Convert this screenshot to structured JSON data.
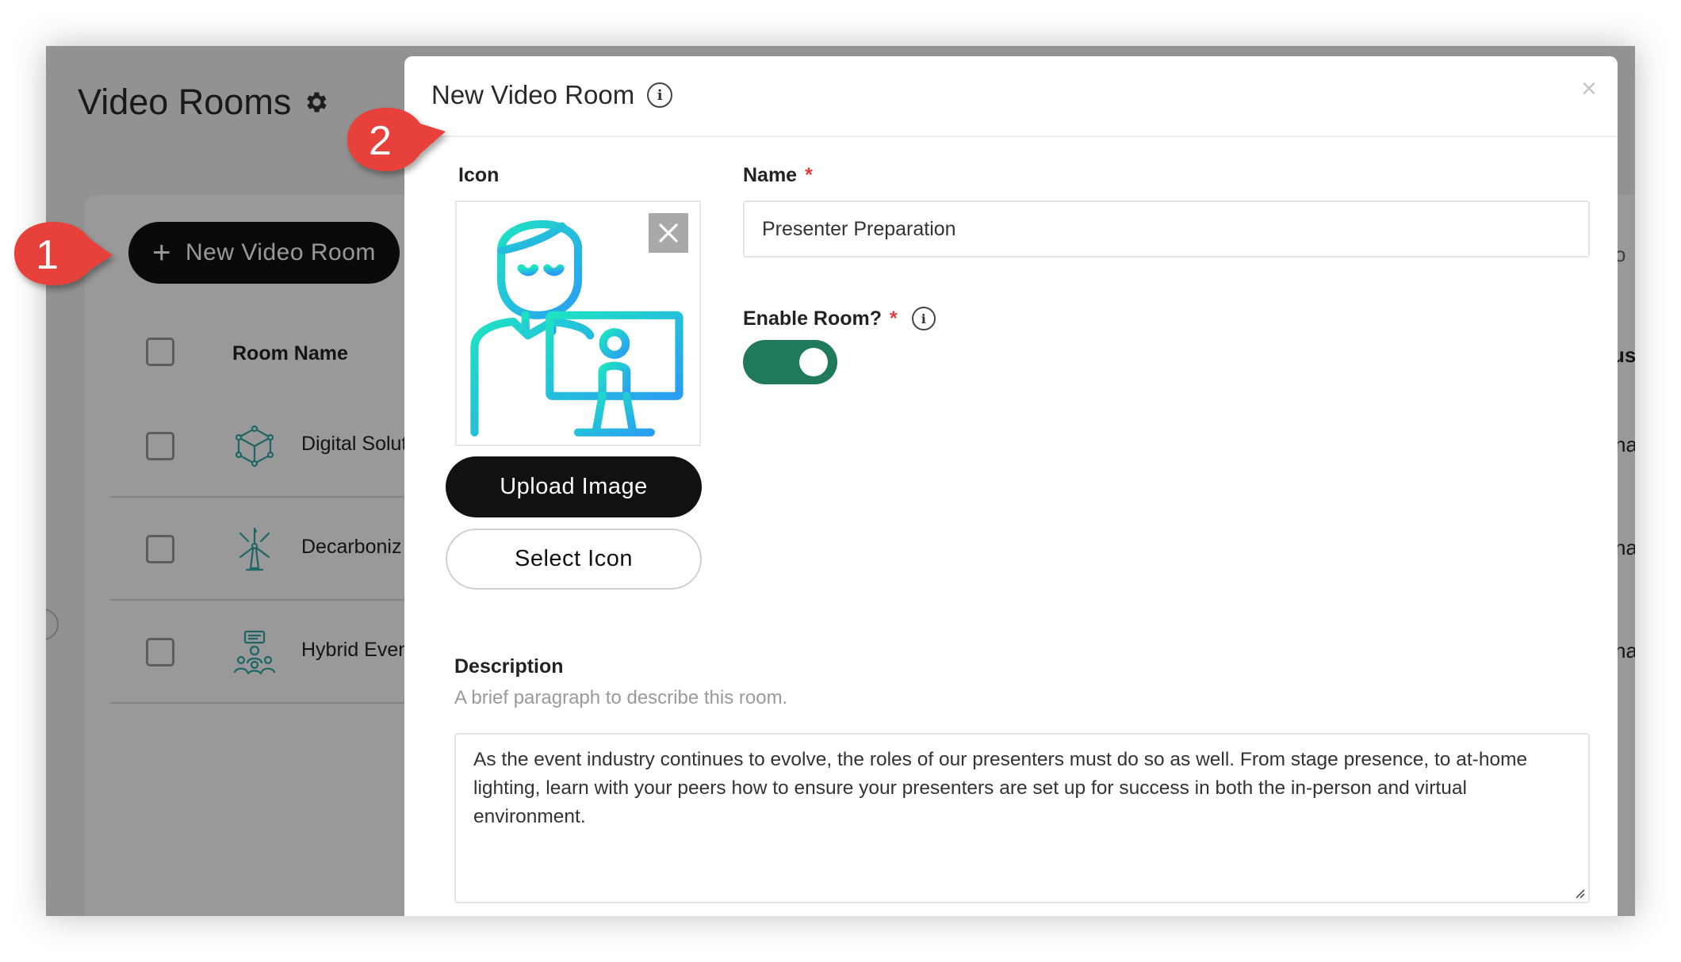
{
  "page": {
    "title": "Video Rooms"
  },
  "toolbar": {
    "new_room_label": "New Video Room"
  },
  "table": {
    "header_room_name": "Room Name",
    "header_right_fragment": "us",
    "rows": [
      {
        "name": "Digital Solut",
        "icon": "network-cube-icon",
        "right_fragment": "na"
      },
      {
        "name": "Decarboniz",
        "icon": "wind-turbine-icon",
        "right_fragment": "na"
      },
      {
        "name": "Hybrid Even",
        "icon": "people-meeting-icon",
        "right_fragment": "na"
      }
    ],
    "search_fragment": "o"
  },
  "modal": {
    "title": "New Video Room",
    "close_symbol": "×",
    "icon_label": "Icon",
    "upload_label": "Upload Image",
    "select_icon_label": "Select Icon",
    "name_label": "Name",
    "required_mark": "*",
    "name_value": "Presenter Preparation",
    "enable_label": "Enable Room?",
    "enable_value": true,
    "description_label": "Description",
    "description_help": "A brief paragraph to describe this room.",
    "description_value": "As the event industry continues to evolve, the roles of our presenters must do so as well. From stage presence, to at-home lighting, learn with your peers how to ensure your presenters are set up for success in both the in-person and virtual environment."
  },
  "callouts": {
    "one": "1",
    "two": "2"
  },
  "colors": {
    "toggle_on": "#1f7a5a",
    "callout_red": "#e8403a",
    "icon_gradient_a": "#1ee3c2",
    "icon_gradient_b": "#2a9df4"
  }
}
